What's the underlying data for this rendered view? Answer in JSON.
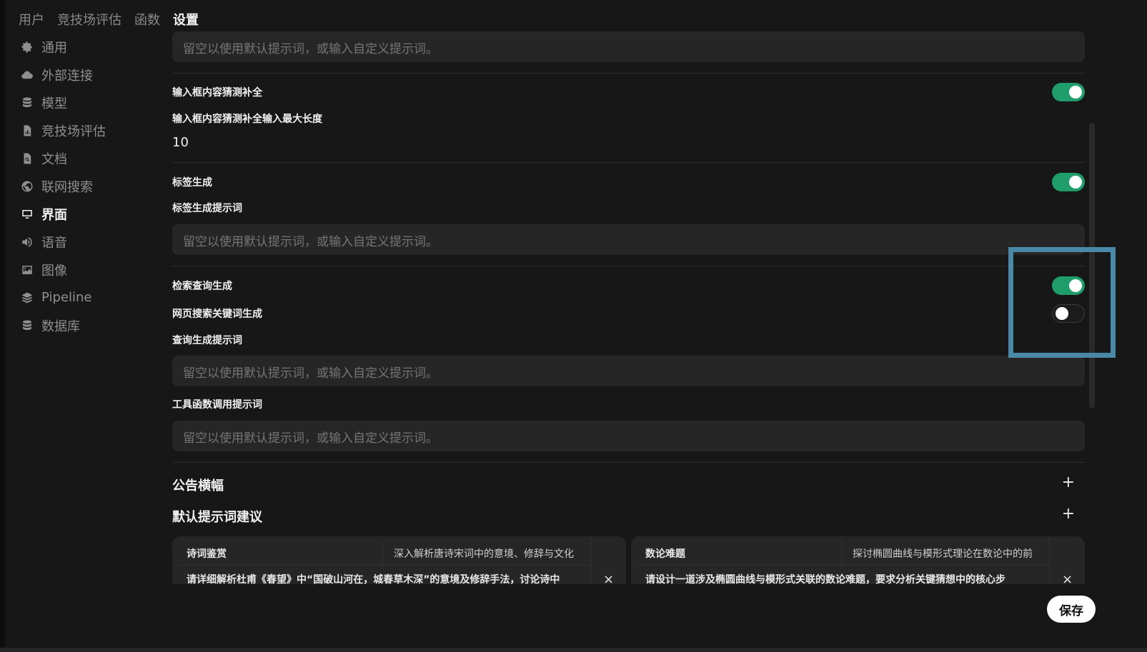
{
  "top_tabs": [
    "用户",
    "竞技场评估",
    "函数",
    "设置"
  ],
  "sidebar": {
    "items": [
      {
        "label": "通用",
        "icon": "gear-icon"
      },
      {
        "label": "外部连接",
        "icon": "cloud-icon"
      },
      {
        "label": "模型",
        "icon": "database-icon"
      },
      {
        "label": "竞技场评估",
        "icon": "document-chart-icon"
      },
      {
        "label": "文档",
        "icon": "document-search-icon"
      },
      {
        "label": "联网搜索",
        "icon": "globe-icon"
      },
      {
        "label": "界面",
        "icon": "monitor-icon"
      },
      {
        "label": "语音",
        "icon": "speaker-icon"
      },
      {
        "label": "图像",
        "icon": "image-icon"
      },
      {
        "label": "Pipeline",
        "icon": "layers-icon"
      },
      {
        "label": "数据库",
        "icon": "database-icon"
      }
    ],
    "active": "界面"
  },
  "main": {
    "placeholder": "留空以使用默认提示词，或输入自定义提示词。",
    "autocomplete": {
      "label": "输入框内容猜测补全",
      "enabled": true
    },
    "autocomplete_max": {
      "label": "输入框内容猜测补全输入最大长度",
      "value": "10"
    },
    "tag_gen": {
      "label": "标签生成",
      "enabled": true
    },
    "tag_prompt_label": "标签生成提示词",
    "retrieval_query": {
      "label": "检索查询生成",
      "enabled": true
    },
    "web_search_query": {
      "label": "网页搜索关键词生成",
      "enabled": false
    },
    "query_prompt_label": "查询生成提示词",
    "tool_prompt_label": "工具函数调用提示词",
    "banner_title": "公告横幅",
    "suggestions_title": "默认提示词建议",
    "suggestions": [
      {
        "title": "诗词鉴赏",
        "subtitle": "深入解析唐诗宋词中的意境、修辞与文化",
        "prompt": "请详细解析杜甫《春望》中“国破山河在，城春草木深”的意境及修辞手法，讨论诗中"
      },
      {
        "title": "数论难题",
        "subtitle": "探讨椭圆曲线与模形式理论在数论中的前",
        "prompt": "请设计一道涉及椭圆曲线与模形式关联的数论难题，要求分析关键猜想中的核心步"
      }
    ],
    "close_glyph": "×",
    "plus_glyph": "+"
  },
  "save_label": "保存",
  "colors": {
    "toggle_on": "#1f9d6b",
    "highlight": "#4a88a8",
    "background": "#171717"
  }
}
